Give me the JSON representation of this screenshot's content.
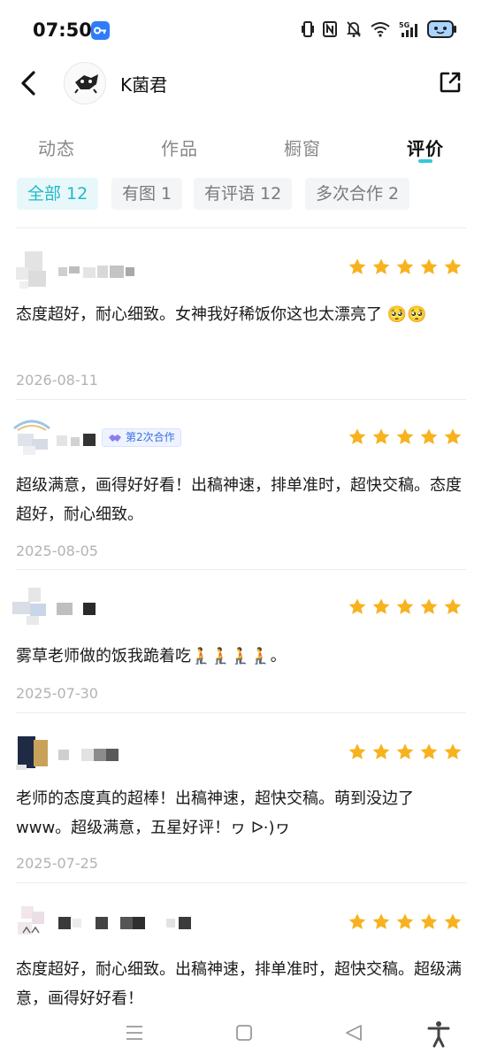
{
  "status": {
    "time": "07:50"
  },
  "header": {
    "name": "K菌君"
  },
  "tabs": [
    {
      "label": "动态"
    },
    {
      "label": "作品"
    },
    {
      "label": "橱窗"
    },
    {
      "label": "评价"
    }
  ],
  "filters": [
    {
      "label": "全部 12"
    },
    {
      "label": "有图 1"
    },
    {
      "label": "有评语 12"
    },
    {
      "label": "多次合作 2"
    }
  ],
  "reviews": [
    {
      "text": "态度超好，耐心细致。女神我好稀饭你这也太漂亮了 🥺🥺",
      "date": "2026-08-11",
      "rating": 5
    },
    {
      "badge": "第2次合作",
      "text": "超级满意，画得好好看！出稿神速，排单准时，超快交稿。态度超好，耐心细致。",
      "date": "2025-08-05",
      "rating": 5
    },
    {
      "text": "雾草老师做的饭我跪着吃🧎🧎🧎🧎。",
      "date": "2025-07-30",
      "rating": 5
    },
    {
      "text": "老师的态度真的超棒！出稿神速，超快交稿。萌到没边了www。超级满意，五星好评！ヮ ᐅ·)ヮ",
      "date": "2025-07-25",
      "rating": 5
    },
    {
      "text": "态度超好，耐心细致。出稿神速，排单准时，超快交稿。超级满意，画得好好看！",
      "rating": 5
    }
  ],
  "colors": {
    "accent": "#22b8c9",
    "star": "#f7b21e",
    "badge": "#3a6fe0"
  }
}
